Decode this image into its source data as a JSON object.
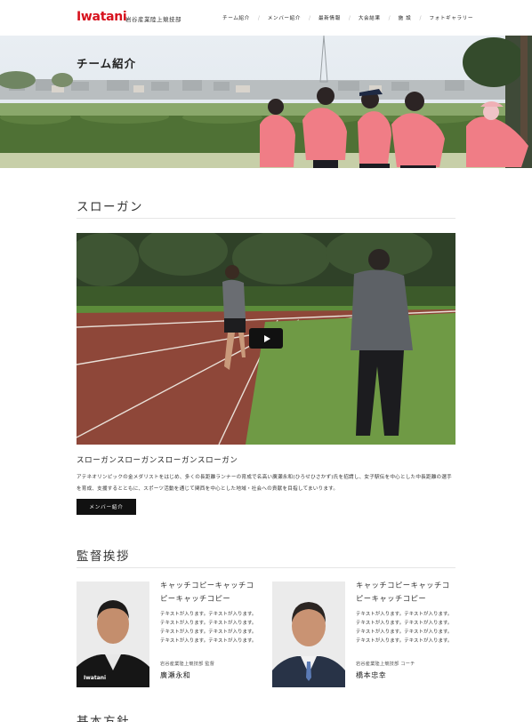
{
  "header": {
    "logo": "Iwatani",
    "logo_sub": "岩谷産業陸上競技部",
    "nav": [
      "チーム紹介",
      "メンバー紹介",
      "最新情報",
      "大会結果",
      "施 設",
      "フォトギャラリー"
    ]
  },
  "hero": {
    "title": "チーム紹介"
  },
  "slogan": {
    "heading": "スローガン",
    "subheading": "スローガンスローガンスローガンスローガン",
    "body": "アテネオリンピックの金メダリストをはじめ、多くの長距離ランナーの育成で名高い廣瀬永和(ひろせひさかず)氏を招請し、女子駅伝を中心とした中長距離の選手を育成、支援するとともに、スポーツ活動を通じて関西を中心とした地域・社会への貢献を目指してまいります。",
    "button_label": "メンバー紹介"
  },
  "greeting": {
    "heading": "監督挨拶",
    "cards": [
      {
        "catch": "キャッチコピーキャッチコピーキャッチコピー",
        "text": "テキストが入ります。テキストが入ります。テキストが入ります。テキストが入ります。テキストが入ります。テキストが入ります。テキストが入ります。テキストが入ります。",
        "role": "岩谷産業陸上競技部 監督",
        "name": "廣瀬永和"
      },
      {
        "catch": "キャッチコピーキャッチコピーキャッチコピー",
        "text": "テキストが入ります。テキストが入ります。テキストが入ります。テキストが入ります。テキストが入ります。テキストが入ります。テキストが入ります。テキストが入ります。",
        "role": "岩谷産業陸上競技部 コーチ",
        "name": "橋本忠幸"
      }
    ]
  },
  "policy": {
    "heading": "基本方針"
  },
  "colors": {
    "brand": "#d7111d",
    "button": "#111111",
    "jacket": "#f07d86"
  }
}
